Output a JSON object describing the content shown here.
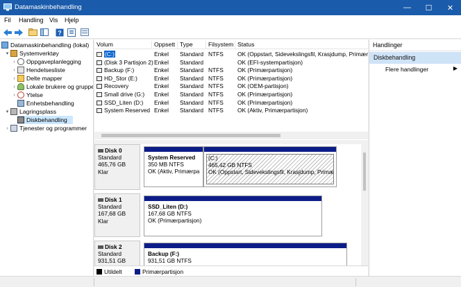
{
  "window": {
    "title": "Datamaskinbehandling",
    "minimize": "—",
    "maximize": "☐",
    "close": "✕"
  },
  "menu": [
    "Fil",
    "Handling",
    "Vis",
    "Hjelp"
  ],
  "toolbar": [
    "back-icon",
    "forward-icon",
    "up-folder-icon",
    "show-hide-tree-icon",
    "help-icon",
    "properties-icon",
    "console-icon"
  ],
  "tree": [
    {
      "label": "Datamaskinbehandling (lokal)",
      "icon": "computer-icon",
      "exp": ""
    },
    {
      "label": "Systemverktøy",
      "icon": "tools-icon",
      "exp": "▾"
    },
    {
      "label": "Oppgaveplanlegging",
      "icon": "clock-icon",
      "exp": "›"
    },
    {
      "label": "Hendelsesliste",
      "icon": "log-icon",
      "exp": "›"
    },
    {
      "label": "Delte mapper",
      "icon": "share-icon",
      "exp": "›"
    },
    {
      "label": "Lokale brukere og grupper",
      "icon": "users-icon",
      "exp": "›"
    },
    {
      "label": "Ytelse",
      "icon": "perf-icon",
      "exp": "›"
    },
    {
      "label": "Enhetsbehandling",
      "icon": "device-icon",
      "exp": ""
    },
    {
      "label": "Lagringsplass",
      "icon": "storage-icon",
      "exp": "▾"
    },
    {
      "label": "Diskbehandling",
      "icon": "disk-icon",
      "exp": ""
    },
    {
      "label": "Tjenester og programmer",
      "icon": "services-icon",
      "exp": "›"
    }
  ],
  "volumes": {
    "headers": [
      "Volum",
      "Oppsett",
      "Type",
      "Filsystem",
      "Status"
    ],
    "rows": [
      [
        "(C:)",
        "Enkel",
        "Standard",
        "NTFS",
        "OK (Oppstart, Sidevekslingsfil, Krasjdump, Primærp"
      ],
      [
        "(Disk 3 Partisjon 2)",
        "Enkel",
        "Standard",
        "",
        "OK (EFI-systempartisjon)"
      ],
      [
        "Backup (F:)",
        "Enkel",
        "Standard",
        "NTFS",
        "OK (Primærpartisjon)"
      ],
      [
        "HD_Stor (E:)",
        "Enkel",
        "Standard",
        "NTFS",
        "OK (Primærpartisjon)"
      ],
      [
        "Recovery",
        "Enkel",
        "Standard",
        "NTFS",
        "OK (OEM-partisjon)"
      ],
      [
        "Small drive (G:)",
        "Enkel",
        "Standard",
        "NTFS",
        "OK (Primærpartisjon)"
      ],
      [
        "SSD_Liten (D:)",
        "Enkel",
        "Standard",
        "NTFS",
        "OK (Primærpartisjon)"
      ],
      [
        "System Reserved",
        "Enkel",
        "Standard",
        "NTFS",
        "OK (Aktiv, Primærpartisjon)"
      ]
    ]
  },
  "disks": [
    {
      "name": "Disk 0",
      "type": "Standard",
      "size": "465,76 GB",
      "state": "Klar",
      "partitions": [
        {
          "name": "System Reserved",
          "size": "350 MB NTFS",
          "status": "OK (Aktiv, Primærpa",
          "selected": false
        },
        {
          "name": "(C:)",
          "size": "465,42 GB NTFS",
          "status": "OK (Oppstart, Sidevekslingsfil, Krasjdump, Primær",
          "selected": true
        }
      ]
    },
    {
      "name": "Disk 1",
      "type": "Standard",
      "size": "167,68 GB",
      "state": "Klar",
      "partitions": [
        {
          "name": "SSD_Liten  (D:)",
          "size": "167,68 GB NTFS",
          "status": "OK (Primærpartisjon)",
          "selected": false
        }
      ]
    },
    {
      "name": "Disk 2",
      "type": "Standard",
      "size": "931,51 GB",
      "state": "",
      "partitions": [
        {
          "name": "Backup  (F:)",
          "size": "931,51 GB NTFS",
          "status": "",
          "selected": false
        }
      ]
    }
  ],
  "legend": [
    {
      "label": "Utildelt",
      "color": "#000000"
    },
    {
      "label": "Primærpartisjon",
      "color": "#0c1d88"
    }
  ],
  "actions": {
    "title": "Handlinger",
    "section": "Diskbehandling",
    "item": "Flere handlinger",
    "arrow": "▶"
  }
}
